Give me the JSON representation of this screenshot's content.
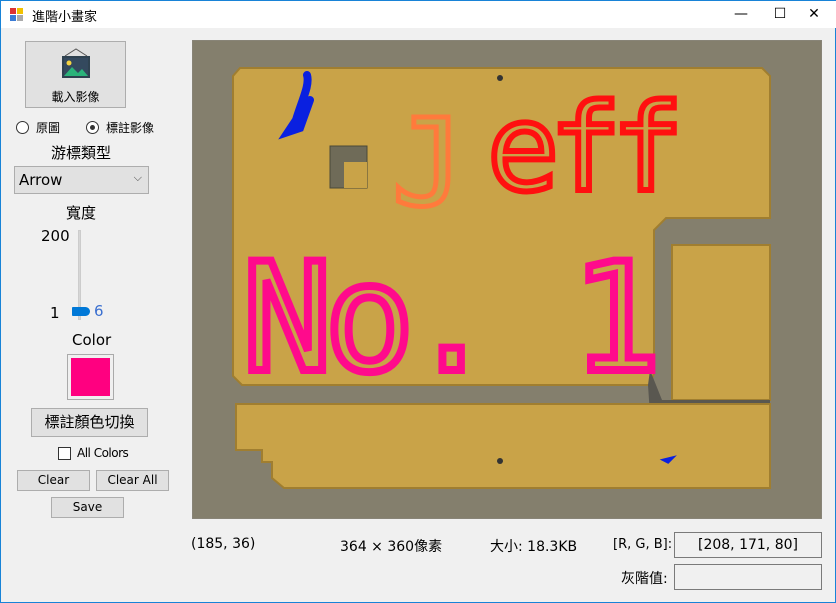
{
  "window": {
    "title": "進階小畫家",
    "minimize": "—",
    "maximize": "☐",
    "close": "✕"
  },
  "sidebar": {
    "load_image_label": "載入影像",
    "radio_original": "原圖",
    "radio_annotated": "標註影像",
    "radio_selected": "標註影像",
    "cursor_type_label": "游標類型",
    "cursor_type_value": "Arrow",
    "width_label": "寬度",
    "width_max": "200",
    "width_min": "1",
    "width_value": "6",
    "color_label": "Color",
    "color_value": "#ff0080",
    "toggle_color_label": "標註顏色切換",
    "all_colors_label": "All Colors",
    "all_colors_checked": false,
    "clear_label": "Clear",
    "clear_all_label": "Clear All",
    "save_label": "Save"
  },
  "canvas": {
    "annotations": [
      {
        "text": "J",
        "color": "#ff7a3c"
      },
      {
        "text": "eff",
        "color": "#ff1010"
      },
      {
        "text": "No. 1",
        "color": "#ff0a8c"
      }
    ],
    "blue_marks_color": "#0a20e0"
  },
  "status": {
    "coords": "(185, 36)",
    "dimensions": "364 × 360像素",
    "size": "大小: 18.3KB",
    "rgb_label": "[R, G, B]:",
    "rgb_value": "[208, 171, 80]",
    "gray_label": "灰階值:",
    "gray_value": ""
  }
}
